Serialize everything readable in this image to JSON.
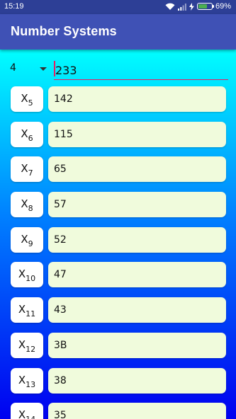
{
  "status_bar": {
    "time": "15:19",
    "battery": "69%",
    "battery_level": 0.69,
    "icons": [
      "wifi-icon",
      "signal-icon",
      "charging-icon",
      "battery-icon"
    ]
  },
  "app_bar": {
    "title": "Number Systems"
  },
  "input_row": {
    "base_selected": "4",
    "number": "233"
  },
  "conversions": [
    {
      "label": "X",
      "base": "5",
      "value": "142"
    },
    {
      "label": "X",
      "base": "6",
      "value": "115"
    },
    {
      "label": "X",
      "base": "7",
      "value": "65"
    },
    {
      "label": "X",
      "base": "8",
      "value": "57"
    },
    {
      "label": "X",
      "base": "9",
      "value": "52"
    },
    {
      "label": "X",
      "base": "10",
      "value": "47"
    },
    {
      "label": "X",
      "base": "11",
      "value": "43"
    },
    {
      "label": "X",
      "base": "12",
      "value": "3B"
    },
    {
      "label": "X",
      "base": "13",
      "value": "38"
    },
    {
      "label": "X",
      "base": "14",
      "value": "35"
    }
  ],
  "colors": {
    "status_bar": "#2d3f96",
    "app_bar": "#3f51b5",
    "gradient_top": "#00ffff",
    "gradient_bottom": "#0000f0",
    "result_bg": "#f0fbdc",
    "accent": "#e91e63"
  }
}
